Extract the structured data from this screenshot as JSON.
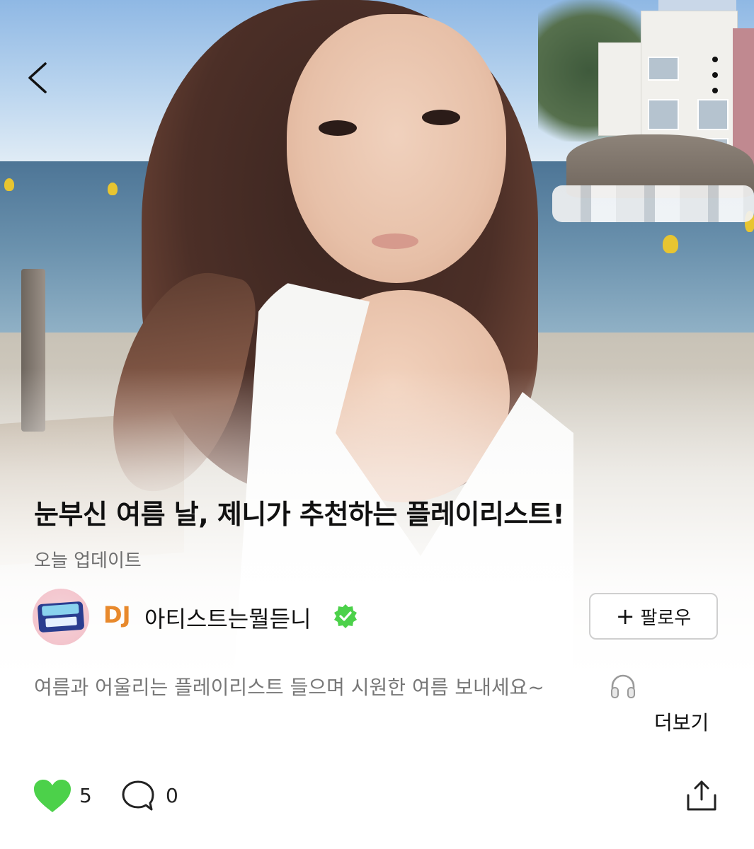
{
  "playlist": {
    "title": "눈부신 여름 날, 제니가 추천하는 플레이리스트!",
    "updated": "오늘 업데이트",
    "description": "여름과 어울리는 플레이리스트 들으며 시원한 여름 보내세요~"
  },
  "curator": {
    "prefix": "DJ",
    "name": "아티스트는뭘듣니",
    "verified": true
  },
  "buttons": {
    "follow_label": "팔로우",
    "more_label": "더보기"
  },
  "stats": {
    "likes": "5",
    "comments": "0"
  },
  "icons": {
    "back": "chevron-left-icon",
    "more": "vertical-dots-icon",
    "verified": "check-badge-icon",
    "headphones": "headphones-icon",
    "like": "heart-icon",
    "comment": "speech-bubble-icon",
    "share": "share-icon"
  },
  "colors": {
    "accent_green": "#4cd14a",
    "dj_orange": "#e8892c",
    "text_primary": "#111111",
    "text_secondary": "#777777"
  }
}
